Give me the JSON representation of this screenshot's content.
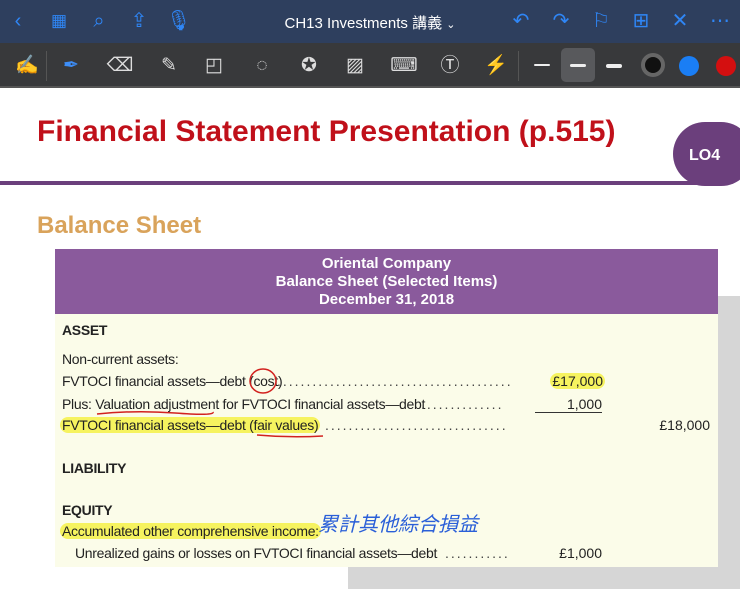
{
  "app": {
    "title": "CH13 Investments 講義",
    "title_chevron": "⌄"
  },
  "toolbar_colors": {
    "black": "#111111",
    "blue": "#1a7ef5",
    "red": "#d40f10"
  },
  "slide": {
    "title": "Financial Statement Presentation (p.515)",
    "badge": "LO4",
    "subtitle": "Balance Sheet",
    "table": {
      "company": "Oriental Company",
      "statement": "Balance Sheet (Selected Items)",
      "date": "December 31, 2018",
      "asset_heading": "ASSET",
      "noncurrent": "Non-current assets:",
      "row_cost_label": "FVTOCI financial assets—debt (cost)",
      "row_cost_amount": "£17,000",
      "row_adj_label": "Plus: Valuation adjustment for FVTOCI financial assets—debt",
      "row_adj_amount": "1,000",
      "row_fv_label": "FVTOCI financial assets—debt (fair values)",
      "row_fv_total": "£18,000",
      "liability_heading": "LIABILITY",
      "equity_heading": "EQUITY",
      "aoci_label": "Accumulated other comprehensive income:",
      "unrealized_label": "Unrealized gains or losses on FVTOCI financial assets—debt",
      "unrealized_amount": "£1,000"
    },
    "handwritten_note": "累計其他綜合損益"
  }
}
